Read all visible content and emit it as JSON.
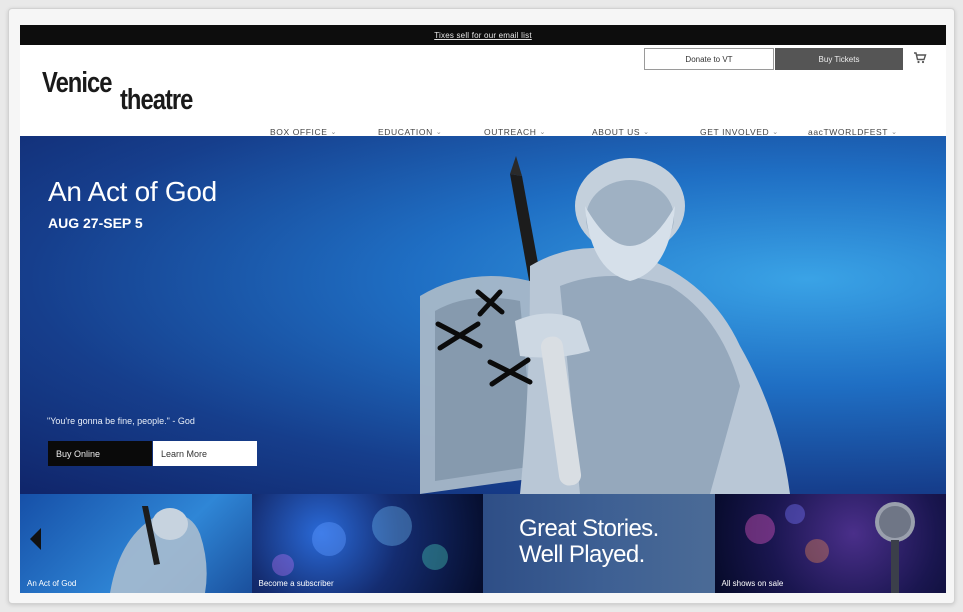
{
  "topbar": {
    "link": "Tixes sell for our email list"
  },
  "header": {
    "logo_line1": "Venice",
    "logo_line2": "theatre",
    "donate_label": "Donate to VT",
    "buy_tickets_label": "Buy Tickets",
    "cart_icon": "cart-icon"
  },
  "nav": {
    "items": [
      {
        "label": "BOX OFFICE"
      },
      {
        "label": "EDUCATION"
      },
      {
        "label": "OUTREACH"
      },
      {
        "label": "ABOUT US"
      },
      {
        "label": "GET INVOLVED"
      },
      {
        "label": "aacTWORLDFEST"
      }
    ],
    "caret": "⌄"
  },
  "hero": {
    "title": "An Act of God",
    "dates": "AUG 27-SEP 5",
    "quote": "\"You're gonna be fine, people.\" - God",
    "buy_label": "Buy Online",
    "learn_label": "Learn More"
  },
  "strip": {
    "items": [
      {
        "caption": "An Act of God"
      },
      {
        "caption": "Become a subscriber"
      },
      {
        "caption": "",
        "big_line1": "Great Stories.",
        "big_line2": "Well Played."
      },
      {
        "caption": "All shows on sale"
      }
    ],
    "prev_icon": "chevron-left-icon"
  },
  "colors": {
    "topbar_bg": "#0d0d0d",
    "buy_tickets_bg": "#555555",
    "hero_blue": "#1f6fc4"
  }
}
